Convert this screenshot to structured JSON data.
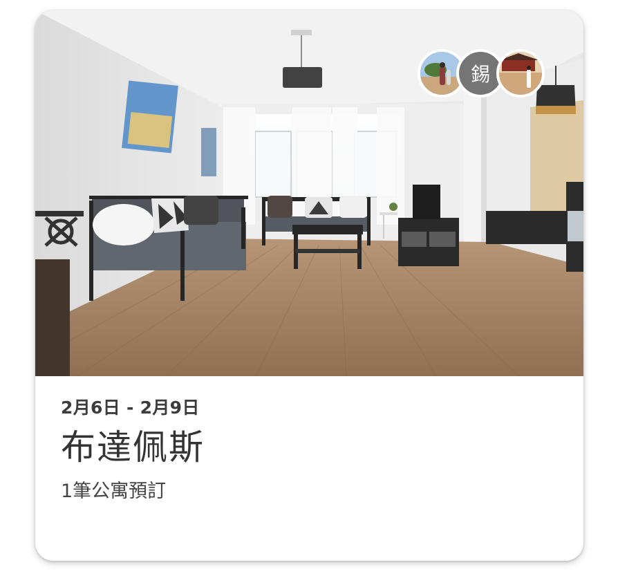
{
  "trip_card": {
    "dates": "2月6日 - 2月9日",
    "destination": "布達佩斯",
    "reservation_summary": "1筆公寓預訂"
  },
  "travelers": [
    {
      "type": "photo",
      "initial": ""
    },
    {
      "type": "initial",
      "initial": "錫"
    },
    {
      "type": "photo",
      "initial": ""
    }
  ],
  "colors": {
    "card_background": "#ffffff",
    "initial_avatar_bg": "#757575",
    "text_primary": "#333333"
  }
}
